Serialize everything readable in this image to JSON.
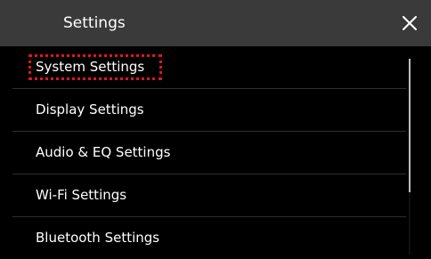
{
  "header": {
    "title": "Settings",
    "close_icon": "close-icon"
  },
  "menu": {
    "items": [
      {
        "label": "System Settings",
        "selected": true
      },
      {
        "label": "Display Settings",
        "selected": false
      },
      {
        "label": "Audio & EQ Settings",
        "selected": false
      },
      {
        "label": "Wi-Fi Settings",
        "selected": false
      },
      {
        "label": "Bluetooth Settings",
        "selected": false
      }
    ]
  },
  "scrollbar": {
    "visible_fraction": 0.68,
    "position_fraction": 0.0
  },
  "colors": {
    "header_bg": "#3a3a3a",
    "list_bg": "#000000",
    "text": "#ffffff",
    "focus_outline": "#e0161b",
    "divider": "#2e2e2e",
    "scroll_thumb": "#bdbdbd"
  }
}
